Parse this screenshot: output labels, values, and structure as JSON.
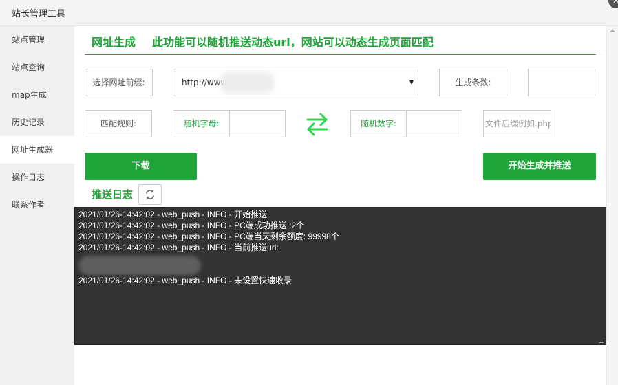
{
  "window": {
    "title": "站长管理工具",
    "close_glyph": "✕"
  },
  "sidebar": {
    "items": [
      {
        "label": "站点管理"
      },
      {
        "label": "站点查询"
      },
      {
        "label": "map生成"
      },
      {
        "label": "历史记录"
      },
      {
        "label": "网址生成器",
        "active": true
      },
      {
        "label": "操作日志"
      },
      {
        "label": "联系作者"
      }
    ]
  },
  "header": {
    "title": "网址生成",
    "description": "此功能可以随机推送动态url，网站可以动态生成页面匹配"
  },
  "form": {
    "prefix_label": "选择网址前缀:",
    "prefix_value": "http://www",
    "count_label": "生成条数:",
    "count_value": "",
    "match_label": "匹配规则:",
    "random_letters_label": "随机字母:",
    "random_letters_value": "",
    "random_digits_label": "随机数字:",
    "random_digits_value": "",
    "suffix_placeholder": "文件后缀例如.php",
    "swap_icon": "swap-arrows-icon"
  },
  "buttons": {
    "download": "下载",
    "start_push": "开始生成并推送"
  },
  "log": {
    "title": "推送日志",
    "refresh_icon": "refresh-icon",
    "lines": [
      "2021/01/26-14:42:02 - web_push - INFO - 开始推送",
      "2021/01/26-14:42:02 - web_push - INFO - PC端成功推送 :2个",
      "2021/01/26-14:42:02 - web_push - INFO - PC端当天剩余额度: 99998个",
      "2021/01/26-14:42:02 - web_push - INFO - 当前推送url:",
      "2021/01/26-14:42:02 - web_push - INFO - 未设置快速收录"
    ]
  },
  "colors": {
    "accent": "#20a53a",
    "log_background": "#333333",
    "sidebar_background": "#f0f0f0"
  }
}
